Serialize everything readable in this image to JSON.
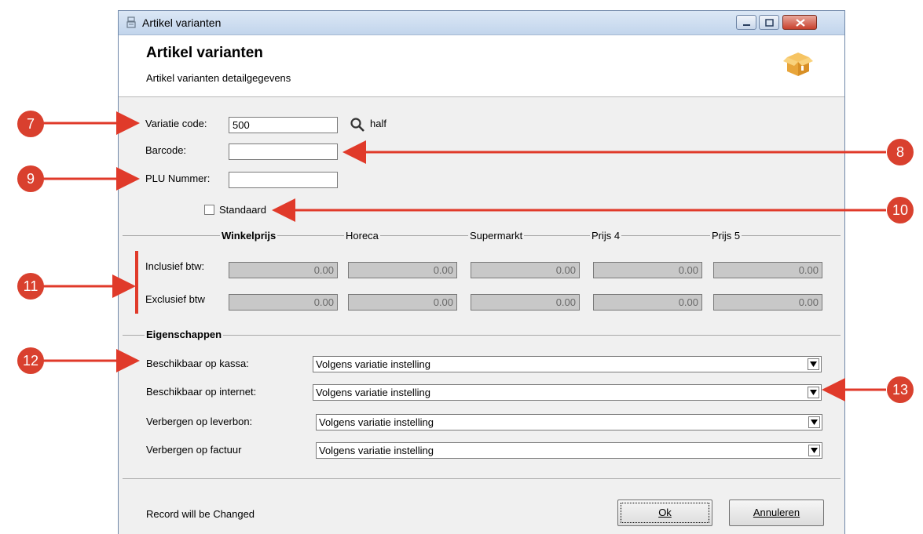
{
  "window": {
    "title": "Artikel varianten",
    "header_title": "Artikel varianten",
    "header_subtitle": "Artikel varianten detailgegevens"
  },
  "form": {
    "variatie_code_label": "Variatie code:",
    "variatie_code_value": "500",
    "variatie_lookup_text": "half",
    "barcode_label": "Barcode:",
    "barcode_value": "",
    "plu_label": "PLU Nummer:",
    "plu_value": "",
    "standaard_label": "Standaard",
    "standaard_checked": false
  },
  "prices": {
    "columns": [
      "Winkelprijs",
      "Horeca",
      "Supermarkt",
      "Prijs 4",
      "Prijs 5"
    ],
    "rows": [
      {
        "label": "Inclusief btw:",
        "values": [
          "0.00",
          "0.00",
          "0.00",
          "0.00",
          "0.00"
        ]
      },
      {
        "label": "Exclusief btw",
        "values": [
          "0.00",
          "0.00",
          "0.00",
          "0.00",
          "0.00"
        ]
      }
    ]
  },
  "properties": {
    "group_label": "Eigenschappen",
    "items": [
      {
        "label": "Beschikbaar op kassa:",
        "value": "Volgens variatie instelling"
      },
      {
        "label": "Beschikbaar op internet:",
        "value": "Volgens variatie instelling"
      },
      {
        "label": "Verbergen op leverbon:",
        "value": "Volgens variatie instelling"
      },
      {
        "label": "Verbergen op factuur",
        "value": "Volgens variatie instelling"
      }
    ]
  },
  "footer": {
    "status": "Record will be Changed",
    "ok_label": "Ok",
    "cancel_label": "Annuleren"
  },
  "annotations": {
    "badges": [
      "7",
      "8",
      "9",
      "10",
      "11",
      "12",
      "13"
    ],
    "color": "#d9402e"
  }
}
